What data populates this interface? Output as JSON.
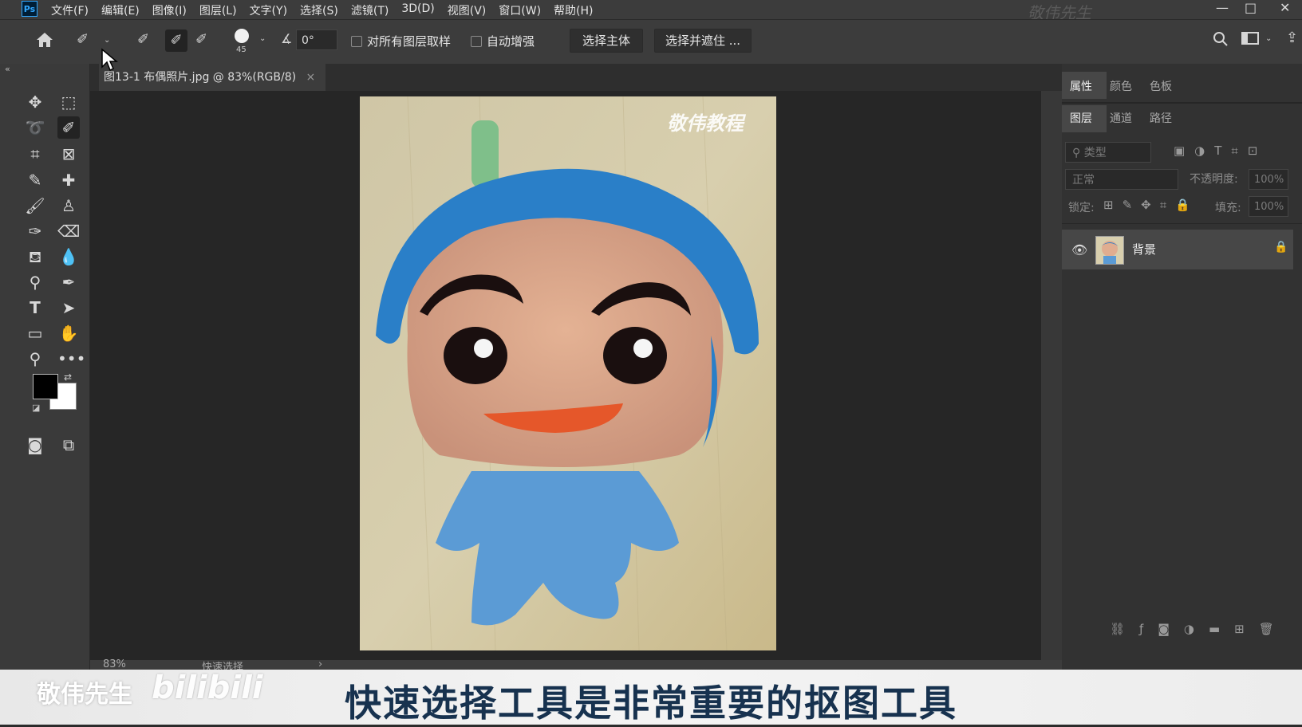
{
  "app": {
    "logo": "Ps",
    "watermark": "敬伟先生"
  },
  "menu": [
    "文件(F)",
    "编辑(E)",
    "图像(I)",
    "图层(L)",
    "文字(Y)",
    "选择(S)",
    "滤镜(T)",
    "3D(D)",
    "视图(V)",
    "窗口(W)",
    "帮助(H)"
  ],
  "options": {
    "brush_size": "45",
    "angle": "0°",
    "sample_all_label": "对所有图层取样",
    "auto_enhance_label": "自动增强",
    "select_subject": "选择主体",
    "select_and_mask": "选择并遮住 ..."
  },
  "document": {
    "tab_title": "图13-1 布偶照片.jpg @ 83%(RGB/8)",
    "close": "×",
    "photo_watermark": "敬伟教程"
  },
  "status": {
    "zoom": "83%",
    "tool": "快速选择",
    "arrow": "›"
  },
  "panels": {
    "top_tabs": [
      "属性",
      "颜色",
      "色板"
    ],
    "layer_tabs": [
      "图层",
      "通道",
      "路径"
    ],
    "filter_placeholder": "类型",
    "blend_mode": "正常",
    "opacity_label": "不透明度:",
    "opacity_value": "100%",
    "lock_label": "锁定:",
    "fill_label": "填充:",
    "fill_value": "100%",
    "layer_name": "背景"
  },
  "subtitle": "快速选择工具是非常重要的抠图工具",
  "brand": "敬伟先生",
  "bili": "bilibili",
  "colors": {
    "accent": "#31a8ff",
    "subtitle": "#17324f",
    "hat": "#2a7fc8",
    "body": "#5b9bd5"
  }
}
